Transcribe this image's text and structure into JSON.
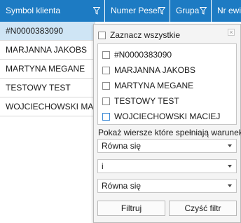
{
  "columns": [
    {
      "label": "Symbol klienta"
    },
    {
      "label": "Numer Pesel"
    },
    {
      "label": "Grupa"
    },
    {
      "label": "Nr ewid"
    }
  ],
  "rows": [
    "#N0000383090",
    "MARJANNA JAKOBS",
    "MARTYNA MEGANE",
    "TESTOWY TEST",
    "WOJCIECHOWSKI MACIEJ"
  ],
  "filter_popup": {
    "select_all_label": "Zaznacz wszystkie",
    "close_symbol": "×",
    "items": [
      "#N0000383090",
      "MARJANNA JAKOBS",
      "MARTYNA MEGANE",
      "TESTOWY TEST",
      "WOJCIECHOWSKI MACIEJ"
    ],
    "condition_label": "Pokaż wiersze które spełniają warunek",
    "operator1": "Równa się",
    "logic": "i",
    "operator2": "Równa się",
    "filter_button": "Filtruj",
    "clear_button": "Czyść filtr"
  },
  "colors": {
    "header": "#1d7bc3",
    "selected_row": "#cfe5f5"
  },
  "icons": {
    "column_filter": "funnel-icon",
    "dropdown": "chevron-down-icon"
  }
}
